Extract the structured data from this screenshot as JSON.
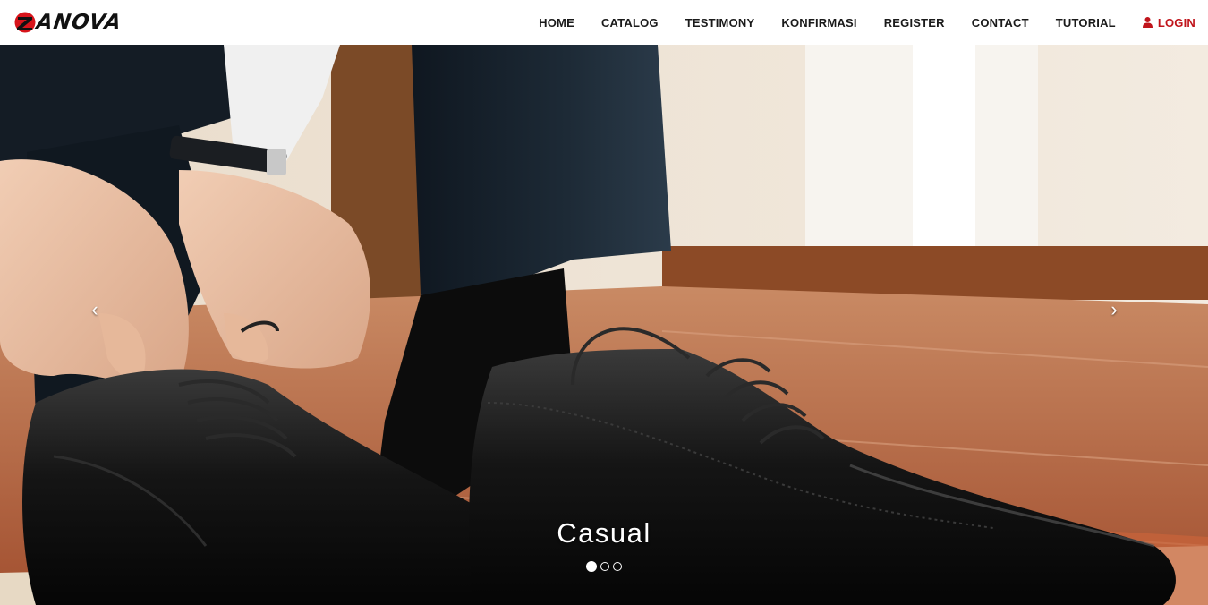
{
  "brand": {
    "name": "ANOVA",
    "mark_letter": "Z",
    "colors": {
      "mark": "#d7141b",
      "text": "#111111"
    }
  },
  "nav": {
    "items": [
      {
        "label": "HOME"
      },
      {
        "label": "CATALOG"
      },
      {
        "label": "TESTIMONY"
      },
      {
        "label": "KONFIRMASI"
      },
      {
        "label": "REGISTER"
      },
      {
        "label": "CONTACT"
      },
      {
        "label": "TUTORIAL"
      }
    ],
    "login": {
      "label": "LOGIN",
      "icon": "user-icon",
      "color": "#c0141b"
    }
  },
  "carousel": {
    "caption": "Casual",
    "prev_icon": "‹",
    "next_icon": "›",
    "slides_count": 3,
    "active_slide": 1
  }
}
